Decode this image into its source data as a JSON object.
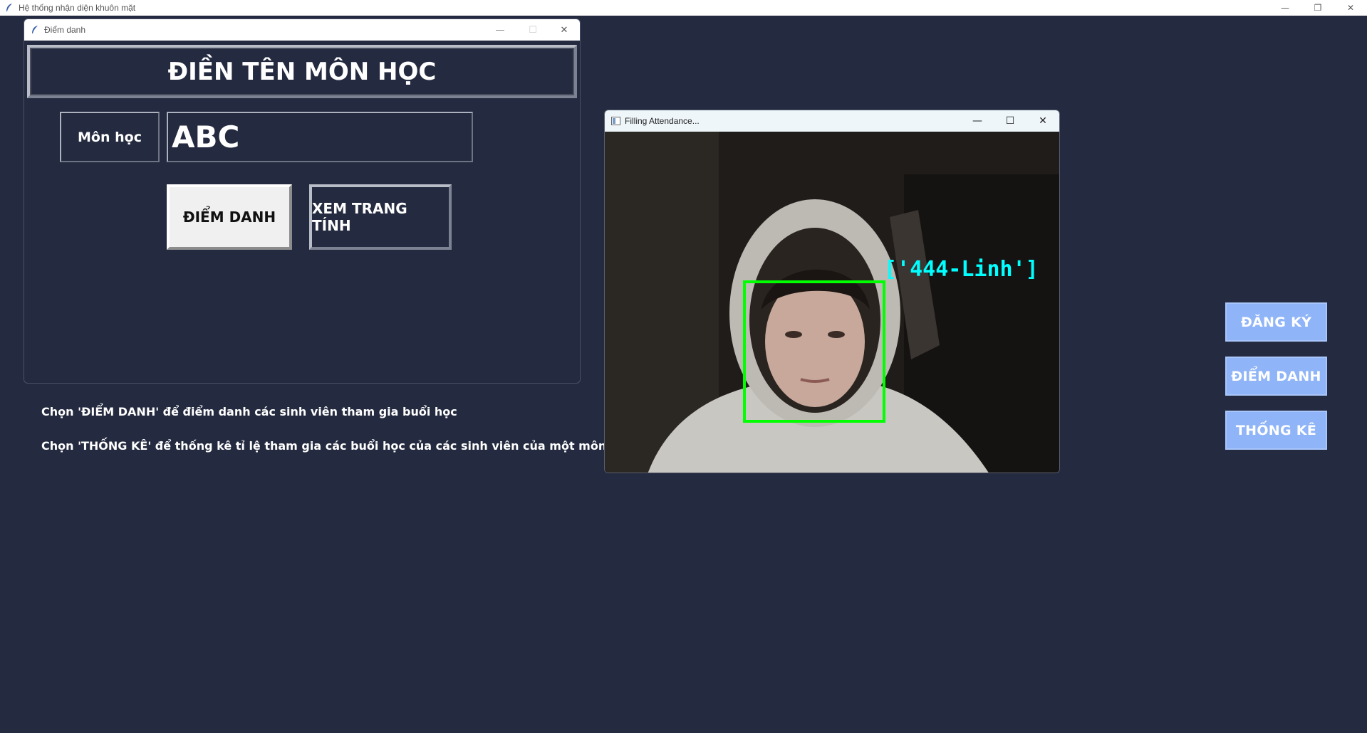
{
  "main_window": {
    "title": "Hệ thống nhận diện khuôn mặt",
    "controls": {
      "minimize": "—",
      "restore": "❐",
      "close": "✕"
    }
  },
  "instructions": {
    "line1": "Chọn 'ĐIỂM DANH' để điểm danh các sinh viên tham gia buổi học",
    "line2": "Chọn 'THỐNG KÊ' để thống kê tỉ lệ tham gia các buổi học của các sinh viên của một môn học"
  },
  "side_menu": {
    "register_label": "ĐĂNG KÝ",
    "attendance_label": "ĐIỂM DANH",
    "statistics_label": "THỐNG KÊ"
  },
  "dialog": {
    "title": "Điểm danh",
    "header": "ĐIỀN TÊN MÔN HỌC",
    "subject_label": "Môn học",
    "subject_value": "ABC",
    "attendance_button": "ĐIỂM DANH",
    "view_sheet_button": "XEM TRANG TÍNH",
    "controls": {
      "minimize": "—",
      "maximize": "☐",
      "close": "✕"
    }
  },
  "camera_window": {
    "title": "Filling Attendance...",
    "recognized_label": "['444-Linh']",
    "controls": {
      "minimize": "—",
      "maximize": "☐",
      "close": "✕"
    }
  },
  "colors": {
    "background": "#242a3f",
    "side_button": "#8fb4f7",
    "face_box": "#00ff00",
    "recognized_text": "#00ffff"
  },
  "icons": {
    "app": "feather-icon",
    "camera_app": "window-icon"
  }
}
